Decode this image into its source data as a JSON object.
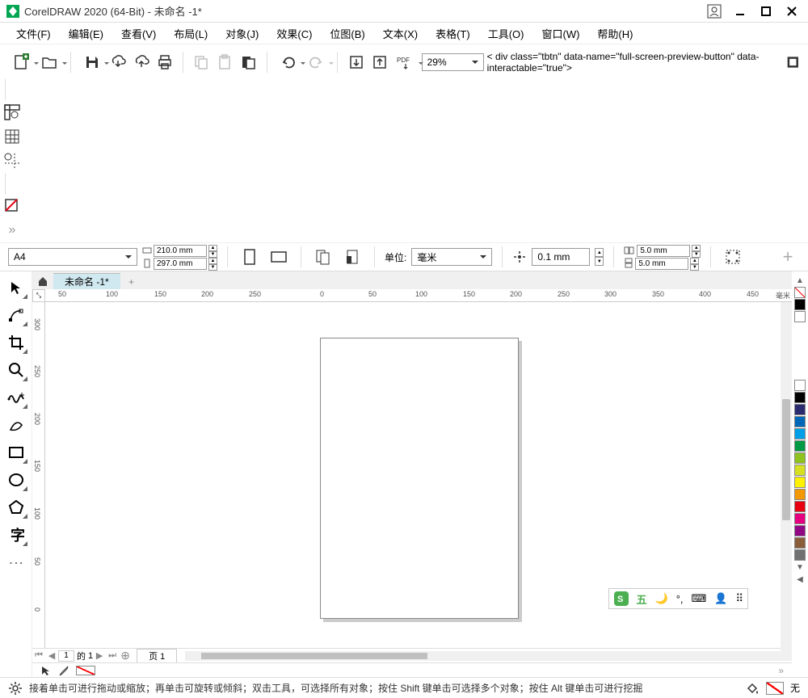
{
  "title": "CorelDRAW 2020 (64-Bit) - 未命名 -1*",
  "menu": [
    "文件(F)",
    "编辑(E)",
    "查看(V)",
    "布局(L)",
    "对象(J)",
    "效果(C)",
    "位图(B)",
    "文本(X)",
    "表格(T)",
    "工具(O)",
    "窗口(W)",
    "帮助(H)"
  ],
  "zoom": "29%",
  "paper": "A4",
  "width": "210.0 mm",
  "height": "297.0 mm",
  "units_label": "单位:",
  "units": "毫米",
  "nudge": "0.1 mm",
  "dup_x": "5.0 mm",
  "dup_y": "5.0 mm",
  "doc_tab": "未命名 -1*",
  "ruler_h": [
    "50",
    "100",
    "150",
    "200",
    "250",
    "0",
    "50",
    "100",
    "150",
    "200",
    "250",
    "300",
    "350",
    "400",
    "450"
  ],
  "ruler_h_unit": "毫米",
  "ruler_v": [
    "300",
    "250",
    "200",
    "150",
    "100",
    "50",
    "0"
  ],
  "page_nav": {
    "current": "1",
    "of_label": "的",
    "total": "1",
    "tab": "页 1"
  },
  "ime": {
    "label": "五"
  },
  "palette": [
    "#000000",
    "#ffffff",
    "#00a0e9",
    "#0068b7",
    "#e60012",
    "#009944",
    "#8fc31f",
    "#f39800",
    "#fff100",
    "#e4007f",
    "#920783",
    "#8a5d3b",
    "#727171"
  ],
  "status": "接着单击可进行拖动或缩放；再单击可旋转或倾斜；双击工具，可选择所有对象；按住 Shift 键单击可选择多个对象；按住 Alt 键单击可进行挖掘",
  "fill_label": "无"
}
